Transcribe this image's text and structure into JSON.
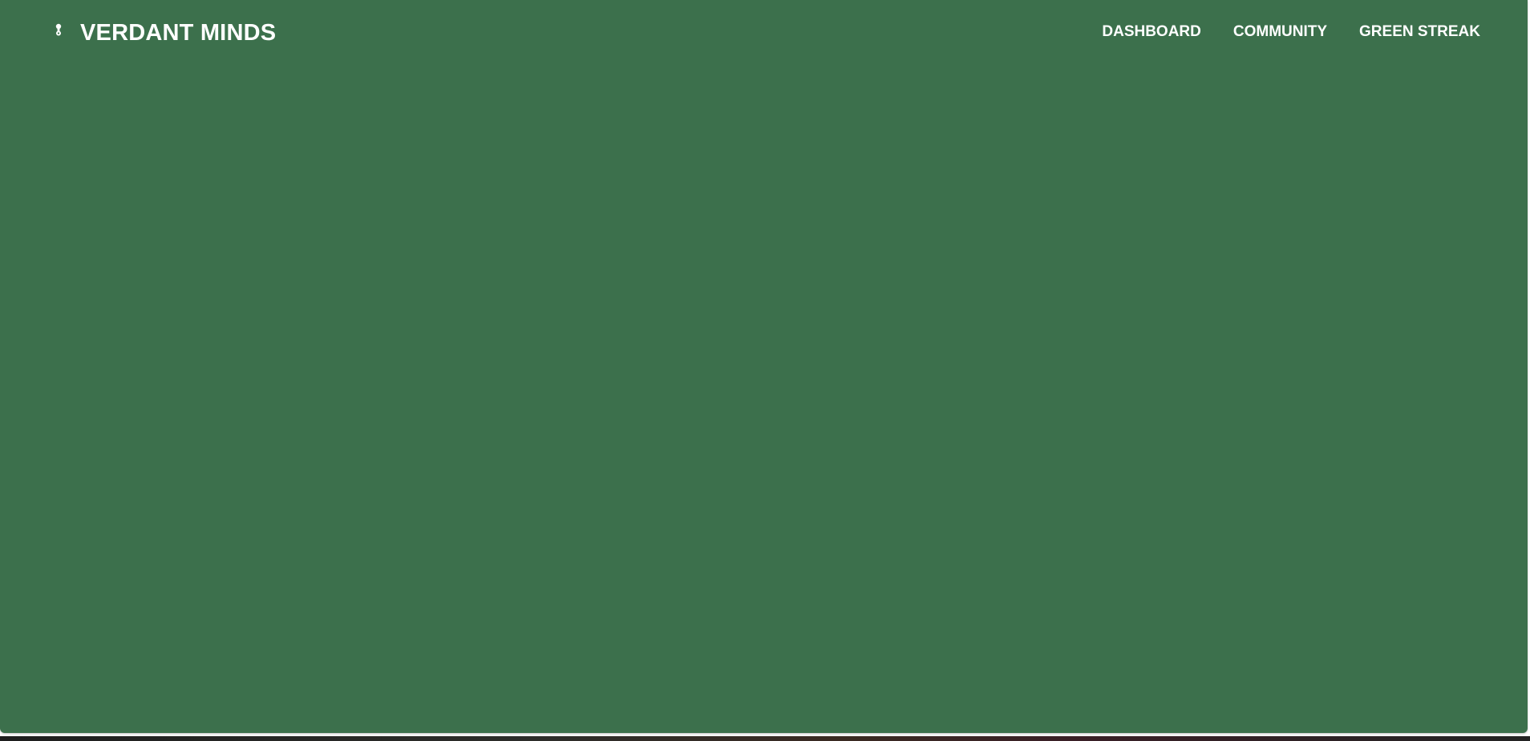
{
  "header": {
    "brand": {
      "icon": "leaf-logo-icon",
      "title": "VERDANT MINDS"
    },
    "nav": [
      {
        "label": "DASHBOARD"
      },
      {
        "label": "COMMUNITY"
      },
      {
        "label": "GREEN STREAK"
      }
    ]
  },
  "colors": {
    "background": "#3c704c",
    "text": "#ffffff"
  }
}
